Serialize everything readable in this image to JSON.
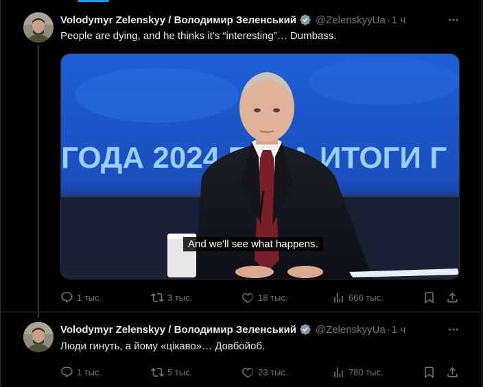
{
  "tweets": [
    {
      "author_name": "Volodymyr Zelenskyy / Володимир Зеленський",
      "handle": "@ZelenskyyUa",
      "separator": "·",
      "time": "1 ч",
      "text": "People are dying, and he thinks it’s “interesting”… Dumbass.",
      "media": {
        "subtitle": "And we'll see what happens.",
        "backdrop_text": "ГОДА 2024 ГОДА ИТОГИ Г"
      },
      "stats": {
        "replies": "1 тыс.",
        "reposts": "3 тыс.",
        "likes": "18 тыс.",
        "views": "666 тыс."
      }
    },
    {
      "author_name": "Volodymyr Zelenskyy / Володимир Зеленський",
      "handle": "@ZelenskyyUa",
      "separator": "·",
      "time": "1 ч",
      "text": "Люди гинуть, а йому «цікаво»… Довбойоб.",
      "stats": {
        "replies": "1 тыс.",
        "reposts": "5 тыс.",
        "likes": "23 тыс.",
        "views": "780 тыс."
      }
    }
  ],
  "colors": {
    "background": "#000000",
    "text": "#e7e9ea",
    "muted": "#71767b",
    "accent": "#1d9bf0",
    "border": "#2f3336"
  },
  "icons": [
    "verified-badge-icon",
    "more-icon",
    "reply-icon",
    "repost-icon",
    "like-icon",
    "views-icon",
    "bookmark-icon",
    "share-icon"
  ]
}
